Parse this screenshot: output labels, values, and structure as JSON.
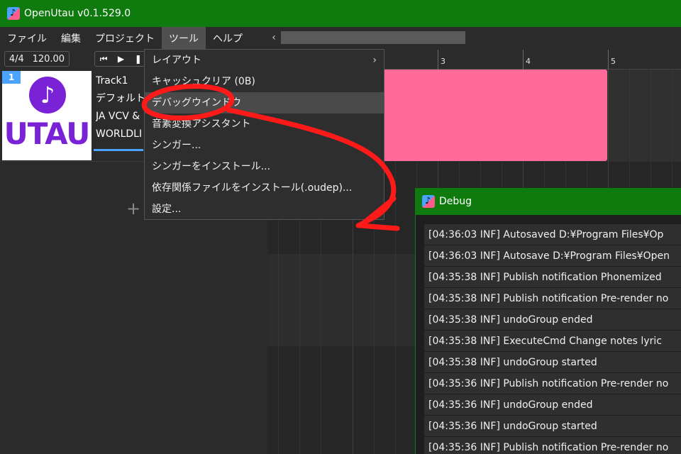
{
  "window": {
    "title": "OpenUtau v0.1.529.0"
  },
  "menubar": {
    "items": [
      {
        "label": "ファイル"
      },
      {
        "label": "編集"
      },
      {
        "label": "プロジェクト"
      },
      {
        "label": "ツール"
      },
      {
        "label": "ヘルプ"
      }
    ]
  },
  "toolbar": {
    "back_icon": "chevron-left-icon"
  },
  "transport": {
    "time_signature": "4/4",
    "tempo": "120.00",
    "icons": [
      "skip-to-start-icon",
      "play-icon",
      "pause-icon"
    ]
  },
  "track": {
    "number": "1",
    "logo_text": "UTAU",
    "name": "Track1",
    "phonemizer": "デフォルト",
    "singer": "JA VCV &",
    "renderer": "WORLDLI"
  },
  "add_track_label": "+",
  "ruler": {
    "marks": [
      "3",
      "4",
      "5"
    ]
  },
  "tools_menu": {
    "items": [
      {
        "label": "レイアウト",
        "submenu": true
      },
      {
        "label": "キャッシュクリア (0B)"
      },
      {
        "label": "デバッグウインドウ",
        "highlighted": true
      },
      {
        "label": "音素変換アシスタント"
      },
      {
        "label": "シンガー..."
      },
      {
        "label": "シンガーをインストール..."
      },
      {
        "label": "依存関係ファイルをインストール(.oudep)..."
      },
      {
        "label": "設定..."
      }
    ]
  },
  "debug_window": {
    "title": "Debug",
    "log": [
      "[04:36:03 INF] Autosaved D:¥Program Files¥Op",
      "[04:36:03 INF] Autosave D:¥Program Files¥Open",
      "[04:35:38 INF] Publish notification Phonemized",
      "[04:35:38 INF] Publish notification Pre-render no",
      "[04:35:38 INF] undoGroup ended",
      "[04:35:38 INF] ExecuteCmd Change notes lyric",
      "[04:35:38 INF] undoGroup started",
      "[04:35:36 INF] Publish notification Pre-render no",
      "[04:35:36 INF] undoGroup ended",
      "[04:35:36 INF] undoGroup started",
      "[04:35:36 INF] Publish notification Pre-render no"
    ]
  },
  "colors": {
    "titlebar": "#0f7b0f",
    "accent_blue": "#4aa3ff",
    "part_pink": "#ff6a99",
    "annotation_red": "#ff1a1a",
    "logo_purple": "#7a22d6"
  }
}
